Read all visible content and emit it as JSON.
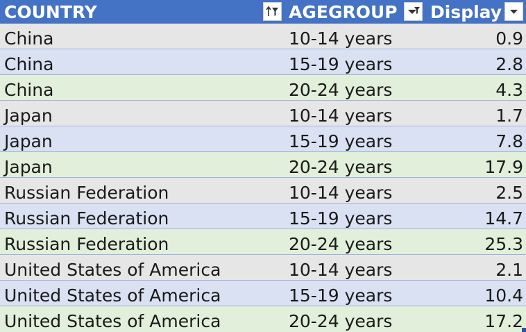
{
  "table": {
    "columns": [
      "COUNTRY",
      "AGEGROUP",
      "Display"
    ],
    "filter_icons": [
      "sort-filter-active-icon",
      "filter-active-icon",
      "dropdown-arrow-icon"
    ],
    "rows": [
      [
        "China",
        "10-14 years",
        "0.9"
      ],
      [
        "China",
        "15-19 years",
        "2.8"
      ],
      [
        "China",
        "20-24 years",
        "4.3"
      ],
      [
        "Japan",
        "10-14 years",
        "1.7"
      ],
      [
        "Japan",
        "15-19 years",
        "7.8"
      ],
      [
        "Japan",
        "20-24 years",
        "17.9"
      ],
      [
        "Russian Federation",
        "10-14 years",
        "2.5"
      ],
      [
        "Russian Federation",
        "15-19 years",
        "14.7"
      ],
      [
        "Russian Federation",
        "20-24 years",
        "25.3"
      ],
      [
        "United States of America",
        "10-14 years",
        "2.1"
      ],
      [
        "United States of America",
        "15-19 years",
        "10.4"
      ],
      [
        "United States of America",
        "20-24 years",
        "17.2"
      ]
    ],
    "colors": {
      "header_bg": "#4472c4",
      "header_text": "#ffffff",
      "band_gray": "#e7e6e6",
      "band_blue": "#d9e1f2",
      "band_green": "#e2efda",
      "row_border": "#9bb4de"
    }
  }
}
